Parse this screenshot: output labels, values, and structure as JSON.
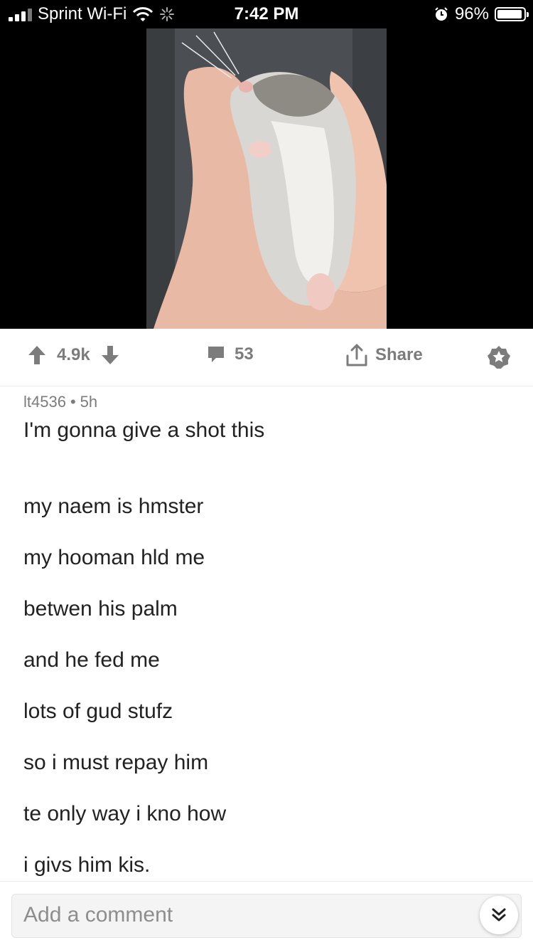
{
  "status_bar": {
    "carrier": "Sprint Wi-Fi",
    "time": "7:42 PM",
    "battery_percent": "96%",
    "battery_level": 0.96
  },
  "media": {
    "alt": "hamster held in a hand"
  },
  "actions": {
    "upvotes": "4.9k",
    "comments": "53",
    "share_label": "Share"
  },
  "post": {
    "author": "lt4536",
    "age": "5h",
    "title": "I'm gonna give a shot this",
    "body_lines": [
      "my naem is hmster",
      "my hooman hld me",
      "betwen his palm",
      "and he fed me",
      "lots of gud stufz",
      "so i must repay him",
      "te only way i kno how",
      "i givs him kis."
    ]
  },
  "comment_bar": {
    "placeholder": "Add a comment"
  },
  "colors": {
    "status_bg": "#000000",
    "icon_gray": "#7c7c7c",
    "text": "#222222"
  }
}
